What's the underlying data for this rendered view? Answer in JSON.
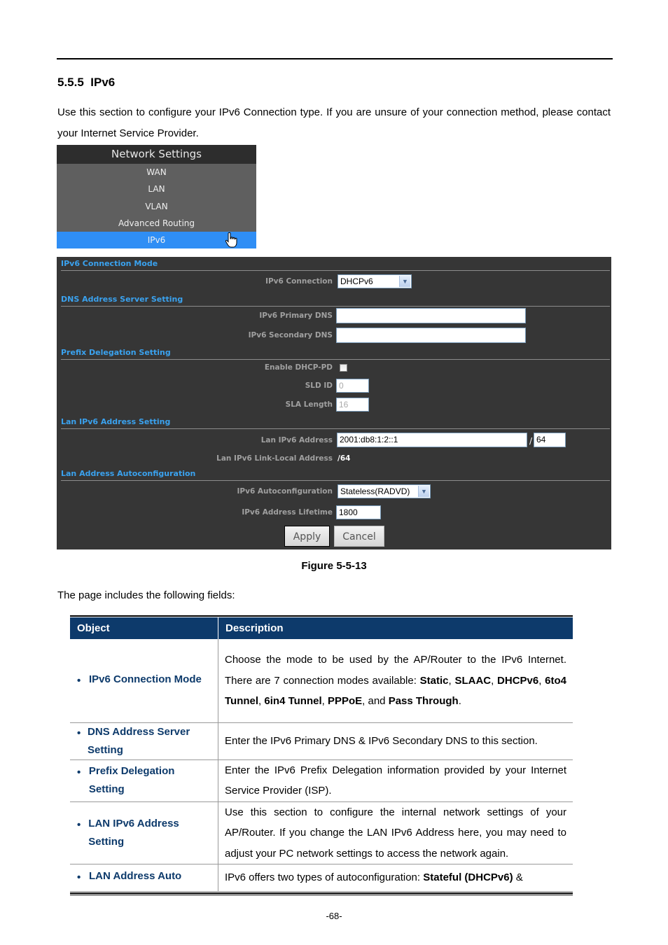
{
  "document": {
    "section_number": "5.5.5",
    "section_title": "IPv6",
    "intro_text": "Use this section to configure your IPv6 Connection type. If you are unsure of your connection method, please contact your Internet Service Provider.",
    "figure_caption": "Figure 5-5-13",
    "fields_intro": "The page includes the following fields:",
    "page_number": "-68-"
  },
  "menu": {
    "title": "Network Settings",
    "items": [
      {
        "label": "WAN",
        "active": false
      },
      {
        "label": "LAN",
        "active": false
      },
      {
        "label": "VLAN",
        "active": false
      },
      {
        "label": "Advanced Routing",
        "active": false
      },
      {
        "label": "IPv6",
        "active": true
      }
    ],
    "active_color": "#2f8ef5"
  },
  "panel": {
    "sections": {
      "connection_mode": "IPv6 Connection Mode",
      "dns": "DNS Address Server Setting",
      "prefix": "Prefix Delegation Setting",
      "lan_ipv6": "Lan IPv6 Address Setting",
      "autoconfig": "Lan Address Autoconfiguration"
    },
    "fields": {
      "ipv6_connection": {
        "label": "IPv6 Connection",
        "value": "DHCPv6"
      },
      "primary_dns": {
        "label": "IPv6 Primary DNS",
        "value": ""
      },
      "secondary_dns": {
        "label": "IPv6 Secondary DNS",
        "value": ""
      },
      "enable_dhcp_pd": {
        "label": "Enable DHCP-PD",
        "checked": false
      },
      "sld_id": {
        "label": "SLD ID",
        "value": "0"
      },
      "sla_length": {
        "label": "SLA Length",
        "value": "16"
      },
      "lan_ipv6_address": {
        "label": "Lan IPv6 Address",
        "value": "2001:db8:1:2::1",
        "separator": "/",
        "prefix_length": "64"
      },
      "link_local": {
        "label": "Lan IPv6 Link-Local Address",
        "value": "/64"
      },
      "autoconfiguration": {
        "label": "IPv6 Autoconfiguration",
        "value": "Stateless(RADVD)"
      },
      "address_lifetime": {
        "label": "IPv6 Address Lifetime",
        "value": "1800"
      }
    },
    "buttons": {
      "apply": "Apply",
      "cancel": "Cancel"
    },
    "section_color": "#3aa2ef"
  },
  "table": {
    "headers": [
      "Object",
      "Description"
    ],
    "header_color": "#0d3a6b",
    "rows": [
      {
        "object": "IPv6 Connection Mode",
        "description_parts": [
          {
            "text": "Choose the mode to be used by the AP/Router to the IPv6 Internet. There are 7 connection modes available: ",
            "bold": false
          },
          {
            "text": "Static",
            "bold": true
          },
          {
            "text": ", ",
            "bold": false
          },
          {
            "text": "SLAAC",
            "bold": true
          },
          {
            "text": ", ",
            "bold": false
          },
          {
            "text": "DHCPv6",
            "bold": true
          },
          {
            "text": ", ",
            "bold": false
          },
          {
            "text": "6to4 Tunnel",
            "bold": true
          },
          {
            "text": ", ",
            "bold": false
          },
          {
            "text": "6in4 Tunnel",
            "bold": true
          },
          {
            "text": ", ",
            "bold": false
          },
          {
            "text": "PPPoE",
            "bold": true
          },
          {
            "text": ", and ",
            "bold": false
          },
          {
            "text": "Pass Through",
            "bold": true
          },
          {
            "text": ".",
            "bold": false
          }
        ]
      },
      {
        "object": "DNS Address Server Setting",
        "description_parts": [
          {
            "text": "Enter the IPv6 Primary DNS & IPv6 Secondary DNS to this section.",
            "bold": false
          }
        ]
      },
      {
        "object": "Prefix Delegation Setting",
        "description_parts": [
          {
            "text": "Enter the IPv6 Prefix Delegation information provided by your Internet Service Provider (ISP).",
            "bold": false
          }
        ]
      },
      {
        "object": "LAN IPv6 Address Setting",
        "description_parts": [
          {
            "text": "Use this section to configure the internal network settings of your AP/Router. If you change the LAN IPv6 Address here, you may need to adjust your PC network settings to access the network again.",
            "bold": false
          }
        ]
      },
      {
        "object": "LAN Address Auto",
        "description_parts": [
          {
            "text": "IPv6 offers two types of autoconfiguration: ",
            "bold": false
          },
          {
            "text": "Stateful (DHCPv6)",
            "bold": true
          },
          {
            "text": " &",
            "bold": false
          }
        ]
      }
    ]
  }
}
